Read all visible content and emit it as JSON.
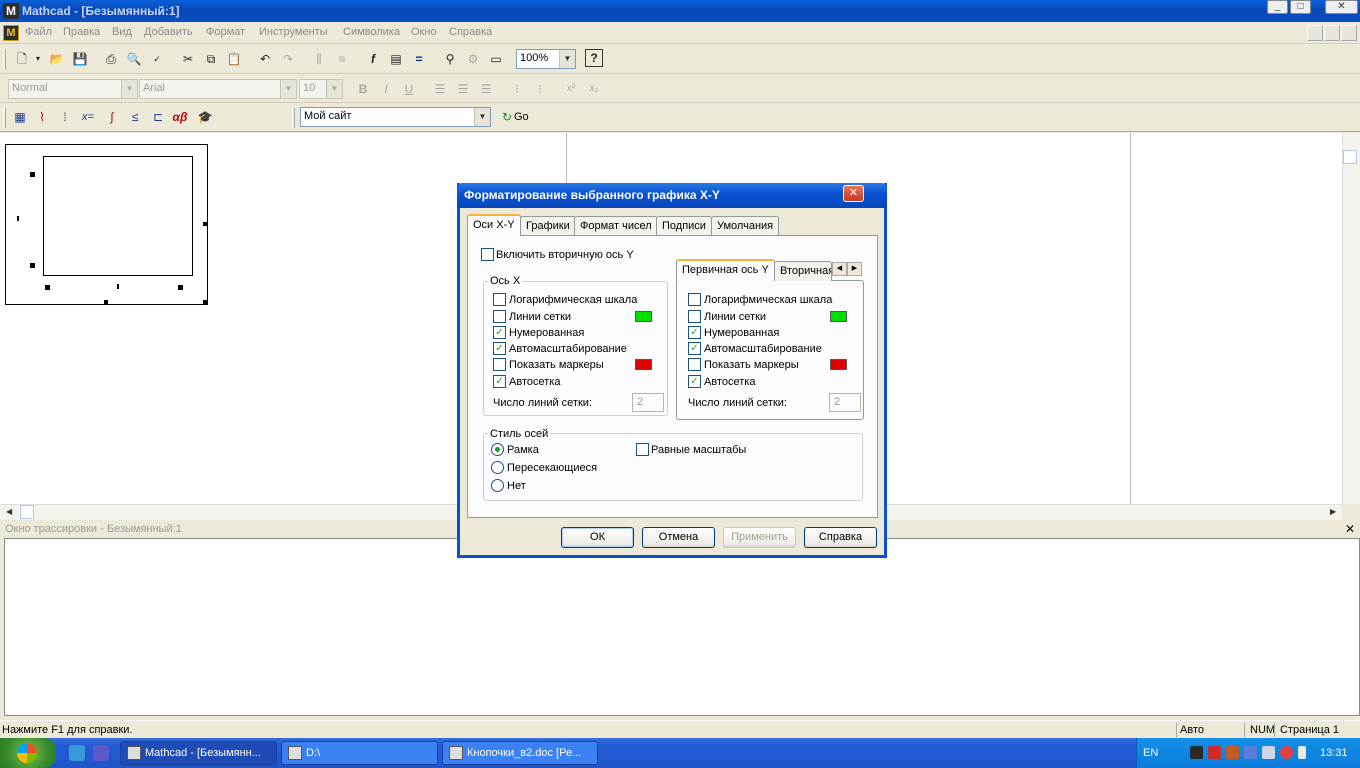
{
  "window": {
    "title": "Mathcad - [Безымянный:1]"
  },
  "menu": [
    "Файл",
    "Правка",
    "Вид",
    "Добавить",
    "Формат",
    "Инструменты",
    "Символика",
    "Окно",
    "Справка"
  ],
  "toolbar": {
    "zoom": "100%",
    "style": "Normal",
    "font": "Arial",
    "size": "10",
    "resource": "Мой сайт",
    "go_label": "Go"
  },
  "trace": {
    "title": "Окно трассировки - Безымянный:1"
  },
  "status": {
    "help": "Нажмите F1 для справки.",
    "mode": "Авто",
    "num": "NUM",
    "page": "Страница 1"
  },
  "taskbar": {
    "tasks": [
      "Mathcad - [Безымянн...",
      "D:\\",
      "Кнопочки_в2.doc [Ре..."
    ],
    "lang": "EN",
    "clock": "13:31"
  },
  "dialog": {
    "title": "Форматирование выбранного графика X-Y",
    "tabs": [
      "Оси X-Y",
      "Графики",
      "Формат чисел",
      "Подписи",
      "Умолчания"
    ],
    "secondary_axis": {
      "label": "Включить вторичную ось Y",
      "checked": false
    },
    "x_axis": {
      "title": "Ось X",
      "options": [
        {
          "label": "Логарифмическая шкала",
          "checked": false
        },
        {
          "label": "Линии сетки",
          "checked": false
        },
        {
          "label": "Нумерованная",
          "checked": true
        },
        {
          "label": "Автомасштабирование",
          "checked": true
        },
        {
          "label": "Показать маркеры",
          "checked": false
        },
        {
          "label": "Автосетка",
          "checked": true
        }
      ],
      "grid_count_label": "Число линий сетки:",
      "grid_count": "2",
      "grid_color": "#00e000",
      "marker_color": "#e00000"
    },
    "y_axis": {
      "tabs": [
        "Первичная ось Y",
        "Вторичная ось Y"
      ],
      "options": [
        {
          "label": "Логарифмическая шкала",
          "checked": false
        },
        {
          "label": "Линии сетки",
          "checked": false
        },
        {
          "label": "Нумерованная",
          "checked": true
        },
        {
          "label": "Автомасштабирование",
          "checked": true
        },
        {
          "label": "Показать маркеры",
          "checked": false
        },
        {
          "label": "Автосетка",
          "checked": true
        }
      ],
      "grid_count_label": "Число линий сетки:",
      "grid_count": "2"
    },
    "axis_style": {
      "title": "Стиль осей",
      "options": [
        {
          "label": "Рамка",
          "selected": true
        },
        {
          "label": "Пересекающиеся",
          "selected": false
        },
        {
          "label": "Нет",
          "selected": false
        }
      ],
      "equal_scale": {
        "label": "Равные масштабы",
        "checked": false
      }
    },
    "buttons": {
      "ok": "ОК",
      "cancel": "Отмена",
      "apply": "Применить",
      "help": "Справка"
    }
  }
}
